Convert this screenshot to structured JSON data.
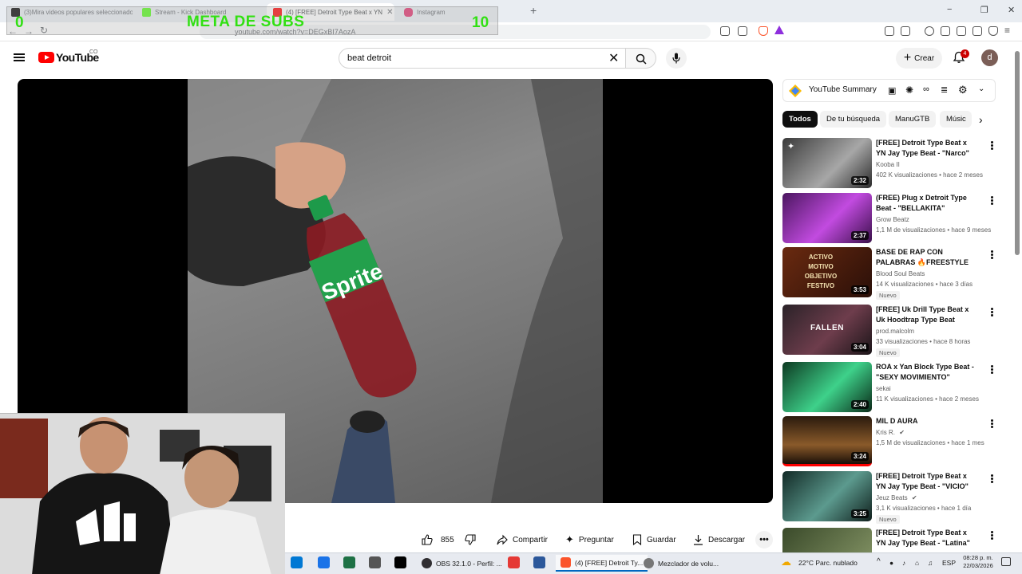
{
  "browser": {
    "tabs": [
      {
        "label": "(3)Mira videos populares seleccionados",
        "color": "#000000"
      },
      {
        "label": "Stream - Kick Dashboard",
        "color": "#53fc18"
      },
      {
        "label": "(4) [FREE] Detroit Type Beat x YN",
        "color": "#ff0000",
        "active": true
      },
      {
        "label": "Instagram",
        "color": "#e1306c"
      }
    ],
    "url": "youtube.com/watch?v=DEGxBI7AozA",
    "new_tab": "+",
    "window_controls": [
      "−",
      "❐",
      "✕"
    ]
  },
  "overlay": {
    "left_count": "0",
    "meta_label": "META DE SUBS",
    "right_count": "10",
    "accent": "#31e012"
  },
  "youtube": {
    "logo_text": "YouTube",
    "country_code": "CO",
    "search_query": "beat detroit",
    "create_label": "Crear",
    "notif_count": "4",
    "avatar_letter": "d"
  },
  "player": {
    "likes": "855",
    "share_label": "Compartir",
    "ask_label": "Preguntar",
    "save_label": "Guardar",
    "download_label": "Descargar",
    "bottle_label": "Sprite"
  },
  "sidebar": {
    "extension_title": "YouTube Summary",
    "chips": [
      "Todos",
      "De tu búsqueda",
      "ManuGTB",
      "Músic"
    ],
    "videos": [
      {
        "title": "[FREE] Detroit Type Beat x YN Jay Type Beat - \"Narco\"",
        "channel": "Kooba II",
        "meta": "402 K visualizaciones • hace 2 meses",
        "duration": "2:32",
        "thumb": "#8a8a8a"
      },
      {
        "title": "(FREE) Plug x Detroit Type Beat - \"BELLAKITA\"",
        "channel": "Grow Beatz",
        "meta": "1,1 M de visualizaciones • hace 9 meses",
        "duration": "2:37",
        "thumb": "#9b2fb8"
      },
      {
        "title": "BASE DE RAP CON PALABRAS 🔥FREESTYLE RAP BEAT | ...",
        "channel": "Blood Soul Beats",
        "meta": "14 K visualizaciones • hace 3 días",
        "duration": "3:53",
        "thumb": "#3a1a12",
        "nuevo": "Nuevo",
        "thumb_text": "ACTIVO MOTIVO OBJETIVO FESTIVO"
      },
      {
        "title": "[FREE] Uk Drill Type Beat x Uk Hoodtrap Type Beat \"FALLEN\" ...",
        "channel": "prod.malcolm",
        "meta": "33 visualizaciones • hace 8 horas",
        "duration": "3:04",
        "thumb": "#4a2a33",
        "nuevo": "Nuevo",
        "thumb_text": "FALLEN"
      },
      {
        "title": "ROA x Yan Block Type Beat - \"SEXY MOVIMIENTO\"",
        "channel": "sekai",
        "meta": "11 K visualizaciones • hace 2 meses",
        "duration": "2:40",
        "thumb": "#1f8f5a"
      },
      {
        "title": "MIL D AURA",
        "channel": "Kris R.",
        "meta": "1,5 M de visualizaciones • hace 1 mes",
        "duration": "3:24",
        "thumb": "#5a3a1e"
      },
      {
        "title": "[FREE] Detroit Type Beat x YN Jay Type Beat - \"VICIO\"",
        "channel": "Jeuz Beats",
        "meta": "3,1 K visualizaciones • hace 1 día",
        "duration": "3:25",
        "thumb": "#2f5a52",
        "nuevo": "Nuevo"
      },
      {
        "title": "[FREE] Detroit Type Beat x YN Jay Type Beat - \"Latina\"",
        "channel": "",
        "meta": "",
        "duration": "",
        "thumb": "#6a7a4a"
      }
    ]
  },
  "taskbar": {
    "apps": [
      "OBS 32.1.0 - Perfil: ...",
      "(4) [FREE] Detroit Ty...",
      "Mezclador de volu..."
    ],
    "weather": "22°C  Parc. nublado",
    "lang": "ESP",
    "time": "08:28 p. m.",
    "date": "22/03/2026"
  }
}
